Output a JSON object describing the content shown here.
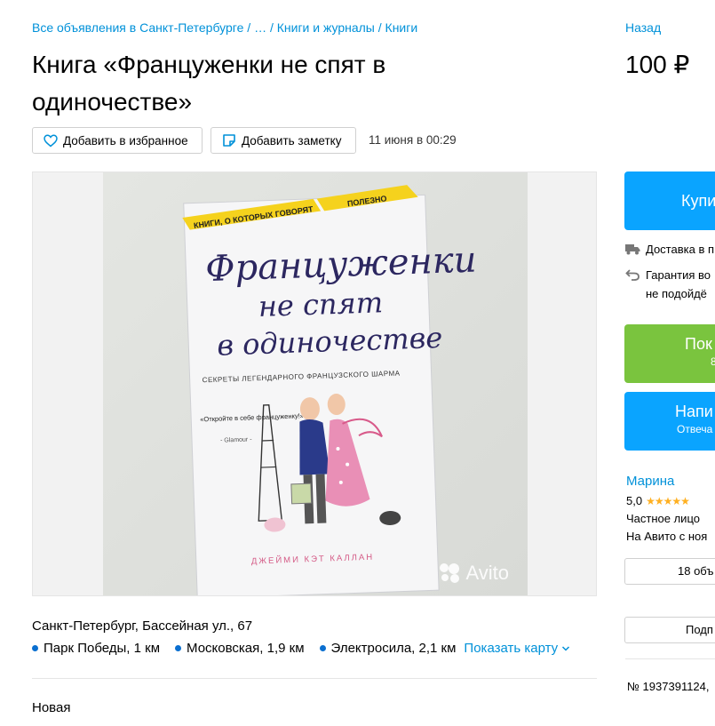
{
  "breadcrumbs": {
    "items": [
      "Все объявления в Санкт-Петербурге",
      "…",
      "Книги и журналы",
      "Книги"
    ],
    "separator": "/"
  },
  "back_label": "Назад",
  "title": "Книга «Француженки не спят в одиночестве»",
  "price": "100 ₽",
  "actions": {
    "favorite_label": "Добавить в избранное",
    "note_label": "Добавить заметку"
  },
  "posted_date": "11 июня в 00:29",
  "photo": {
    "watermark": "Avito",
    "book": {
      "top_left_banner": "КНИГИ, О КОТОРЫХ ГОВОРЯТ",
      "top_right_banner": "ПОЛЕЗНО",
      "title_lines": [
        "Француженки",
        "не спят",
        "в одиночестве"
      ],
      "subtitle": "СЕКРЕТЫ ЛЕГЕНДАРНОГО ФРАНЦУЗСКОГО ШАРМА",
      "quote": "«Откройте в себе француженку!»",
      "quote_source": "- Glamour -",
      "author": "ДЖЕЙМИ КЭТ КАЛЛАН"
    }
  },
  "location": {
    "address": "Санкт-Петербург, Бассейная ул., 67",
    "metro": [
      {
        "name": "Парк Победы",
        "distance": "1 км"
      },
      {
        "name": "Московская",
        "distance": "1,9 км"
      },
      {
        "name": "Электросила",
        "distance": "2,1 км"
      }
    ],
    "show_map_label": "Показать карту"
  },
  "condition": "Новая",
  "sidebar": {
    "buy_label": "Купи",
    "features": [
      "Доставка в п",
      "Гарантия во",
      "не подойдё"
    ],
    "show_phone_label": "Пок",
    "show_phone_sub": "8",
    "write_label": "Напи",
    "write_sub": "Отвеча",
    "seller": {
      "name": "Марина",
      "rating": "5,0",
      "stars": "★★★★★",
      "type": "Частное лицо",
      "since": "На Авито с ноя"
    },
    "ads_count_label": "18 объ",
    "subscribe_label": "Подп",
    "ad_number": "№ 1937391124,"
  },
  "colors": {
    "link": "#0091d9",
    "primary": "#0aa4ff",
    "green": "#7ac43e",
    "star": "#ffb021",
    "metro_dot": "#0a6fd0"
  }
}
